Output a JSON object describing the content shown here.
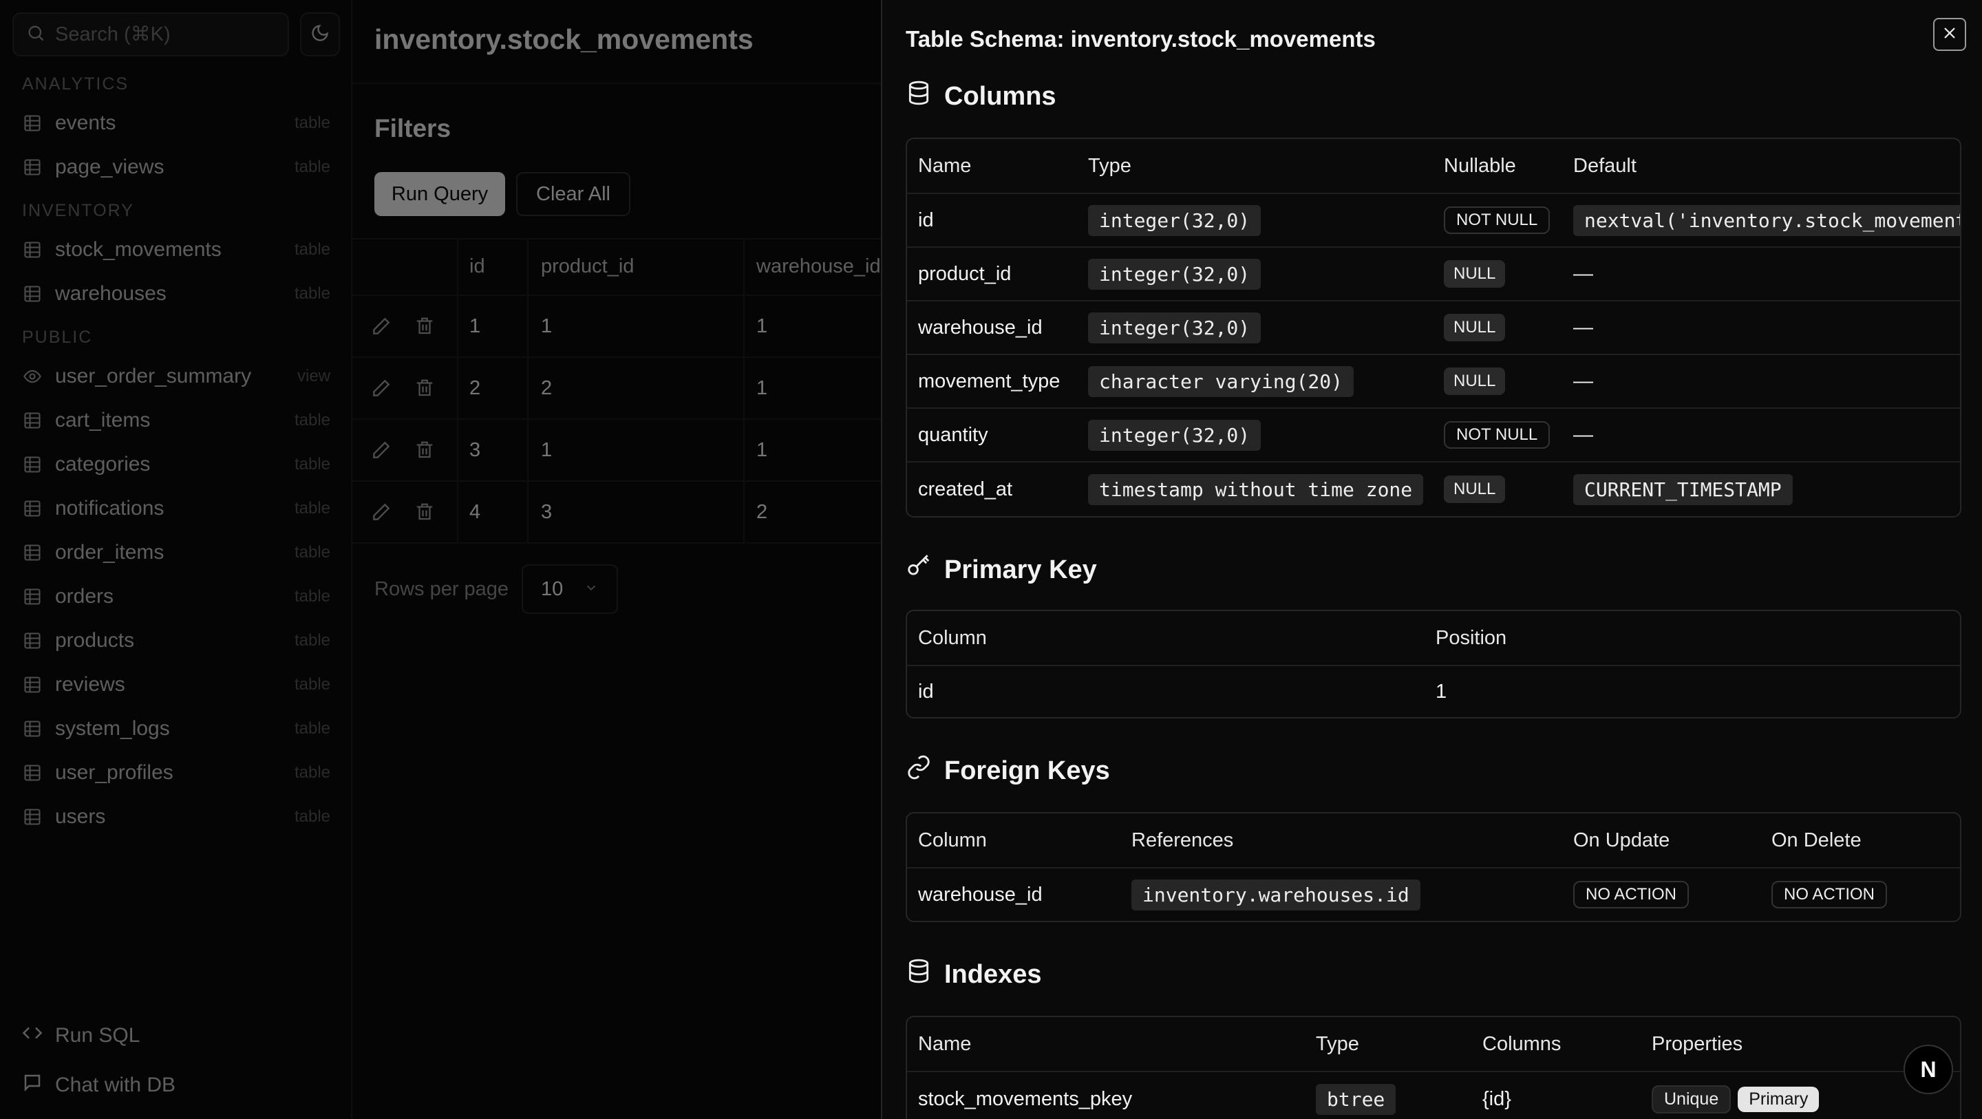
{
  "sidebar": {
    "search_placeholder": "Search (⌘K)",
    "sections": [
      {
        "label": "ANALYTICS",
        "items": [
          {
            "label": "events",
            "kind": "table"
          },
          {
            "label": "page_views",
            "kind": "table"
          }
        ]
      },
      {
        "label": "INVENTORY",
        "items": [
          {
            "label": "stock_movements",
            "kind": "table"
          },
          {
            "label": "warehouses",
            "kind": "table"
          }
        ]
      },
      {
        "label": "PUBLIC",
        "items": [
          {
            "label": "user_order_summary",
            "kind": "view"
          },
          {
            "label": "cart_items",
            "kind": "table"
          },
          {
            "label": "categories",
            "kind": "table"
          },
          {
            "label": "notifications",
            "kind": "table"
          },
          {
            "label": "order_items",
            "kind": "table"
          },
          {
            "label": "orders",
            "kind": "table"
          },
          {
            "label": "products",
            "kind": "table"
          },
          {
            "label": "reviews",
            "kind": "table"
          },
          {
            "label": "system_logs",
            "kind": "table"
          },
          {
            "label": "user_profiles",
            "kind": "table"
          },
          {
            "label": "users",
            "kind": "table"
          }
        ]
      }
    ],
    "footer": {
      "run_sql": "Run SQL",
      "chat": "Chat with DB"
    }
  },
  "main": {
    "title": "inventory.stock_movements",
    "filters_title": "Filters",
    "run_query": "Run Query",
    "clear_all": "Clear All",
    "grid": {
      "headers": [
        "id",
        "product_id",
        "warehouse_id"
      ],
      "rows": [
        [
          "1",
          "1",
          "1"
        ],
        [
          "2",
          "2",
          "1"
        ],
        [
          "3",
          "1",
          "1"
        ],
        [
          "4",
          "3",
          "2"
        ]
      ]
    },
    "rows_per_page_label": "Rows per page",
    "rows_per_page_value": "10"
  },
  "panel": {
    "title": "Table Schema: inventory.stock_movements",
    "columns": {
      "heading": "Columns",
      "headers": [
        "Name",
        "Type",
        "Nullable",
        "Default"
      ],
      "rows": [
        {
          "name": "id",
          "type": "integer(32,0)",
          "nullable": "NOT NULL",
          "default": "nextval('inventory.stock_movements_id_seq'::regclass)"
        },
        {
          "name": "product_id",
          "type": "integer(32,0)",
          "nullable": "NULL",
          "default": "—"
        },
        {
          "name": "warehouse_id",
          "type": "integer(32,0)",
          "nullable": "NULL",
          "default": "—"
        },
        {
          "name": "movement_type",
          "type": "character varying(20)",
          "nullable": "NULL",
          "default": "—"
        },
        {
          "name": "quantity",
          "type": "integer(32,0)",
          "nullable": "NOT NULL",
          "default": "—"
        },
        {
          "name": "created_at",
          "type": "timestamp without time zone",
          "nullable": "NULL",
          "default": "CURRENT_TIMESTAMP"
        }
      ]
    },
    "primary_key": {
      "heading": "Primary Key",
      "headers": [
        "Column",
        "Position"
      ],
      "rows": [
        {
          "column": "id",
          "position": "1"
        }
      ]
    },
    "foreign_keys": {
      "heading": "Foreign Keys",
      "headers": [
        "Column",
        "References",
        "On Update",
        "On Delete"
      ],
      "rows": [
        {
          "column": "warehouse_id",
          "references": "inventory.warehouses.id",
          "on_update": "NO ACTION",
          "on_delete": "NO ACTION"
        }
      ]
    },
    "indexes": {
      "heading": "Indexes",
      "headers": [
        "Name",
        "Type",
        "Columns",
        "Properties"
      ],
      "rows": [
        {
          "name": "stock_movements_pkey",
          "type": "btree",
          "columns": "{id}",
          "props": [
            "Unique",
            "Primary"
          ]
        }
      ]
    }
  },
  "logo_letter": "N"
}
